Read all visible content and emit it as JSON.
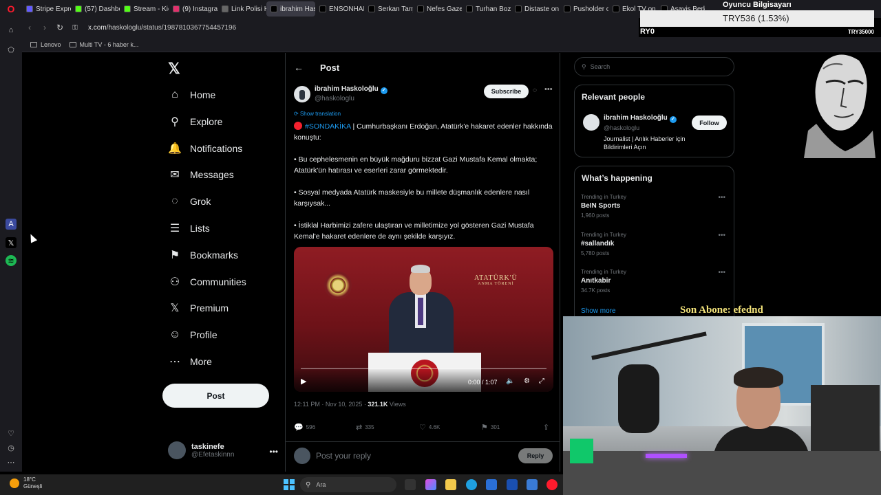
{
  "browser": {
    "tabs": [
      {
        "label": "Stripe Express",
        "color": "#635bff"
      },
      {
        "label": "(57) Dashboar",
        "color": "#53fc18"
      },
      {
        "label": "Stream - Kick",
        "color": "#53fc18"
      },
      {
        "label": "(9) Instagram",
        "color": "#e1306c"
      },
      {
        "label": "Link Polisi Hak",
        "color": "#666666"
      },
      {
        "label": "ibrahim Haskoloğlu on",
        "color": "#000000",
        "active": true
      },
      {
        "label": "ENSONHABER",
        "color": "#000000"
      },
      {
        "label": "Serkan Tanyıld",
        "color": "#000000"
      },
      {
        "label": "Nefes Gazete",
        "color": "#000000"
      },
      {
        "label": "Turhan Bozku",
        "color": "#000000"
      },
      {
        "label": "Distaste on X",
        "color": "#000000"
      },
      {
        "label": "Pusholder on",
        "color": "#000000"
      },
      {
        "label": "Ekol TV on X",
        "color": "#000000"
      },
      {
        "label": "Asayis Berkm",
        "color": "#000000"
      }
    ],
    "url_host": "x.com",
    "url_path": "/haskologlu/status/1987810367754457196",
    "bookmarks": [
      "Lenovo",
      "Multi TV - 6 haber k..."
    ]
  },
  "nav": {
    "items": [
      {
        "label": "Home",
        "icon": "⌂"
      },
      {
        "label": "Explore",
        "icon": "⚲"
      },
      {
        "label": "Notifications",
        "icon": "🔔"
      },
      {
        "label": "Messages",
        "icon": "✉"
      },
      {
        "label": "Grok",
        "icon": "◌"
      },
      {
        "label": "Lists",
        "icon": "☰"
      },
      {
        "label": "Bookmarks",
        "icon": "⚑"
      },
      {
        "label": "Communities",
        "icon": "⚇"
      },
      {
        "label": "Premium",
        "icon": "𝕏"
      },
      {
        "label": "Profile",
        "icon": "☺"
      },
      {
        "label": "More",
        "icon": "⋯"
      }
    ],
    "post_button": "Post",
    "account_name": "taskinefe",
    "account_handle": "@Efetaskinnn"
  },
  "post": {
    "header_title": "Post",
    "author_name": "ibrahim Haskoloğlu",
    "author_handle": "@haskologlu",
    "subscribe": "Subscribe",
    "show_translation": "Show translation",
    "hashtag": "#SONDAKİKA",
    "text_intro": "| Cumhurbaşkanı Erdoğan, Atatürk'e hakaret edenler hakkında konuştu:",
    "para1": "• Bu cephelesmenin en büyük mağduru bizzat Gazi Mustafa Kemal olmakta; Atatürk'ün hatırası ve eserleri zarar görmektedir.",
    "para2": "• Sosyal medyada Atatürk maskesiyle bu millete düşmanlık edenlere nasıl karşıysak...",
    "para3": "• İstiklal Harbimizi zafere ulaştıran ve milletimize yol gösteren Gazi Mustafa Kemal'e hakaret edenlere de aynı şekilde karşıyız.",
    "video_caption": "ATATÜRK'Ü",
    "video_caption2": "ANMA TÖRENİ",
    "video_time": "0:00 / 1:07",
    "video_progress": 0,
    "timestamp": "12:11 PM · Nov 10, 2025 · ",
    "views_count": "321.1K",
    "views_label": " Views",
    "replies": "596",
    "reposts": "335",
    "likes": "4.6K",
    "bookmarks": "301",
    "reply_placeholder": "Post your reply",
    "reply_button": "Reply"
  },
  "right": {
    "search_placeholder": "Search",
    "relevant_title": "Relevant people",
    "rp_name": "ibrahim Haskoloğlu",
    "rp_handle": "@haskologlu",
    "rp_bio": "Journalist | Anlık Haberler için Bildirimleri Açın",
    "follow": "Follow",
    "happening_title": "What’s happening",
    "trends": [
      {
        "context": "Trending in Turkey",
        "name": "BeIN Sports",
        "count": "1,960 posts"
      },
      {
        "context": "Trending in Turkey",
        "name": "#sallandık",
        "count": "5,780 posts"
      },
      {
        "context": "Trending in Turkey",
        "name": "Anıtkabir",
        "count": "34.7K posts"
      }
    ],
    "show_more": "Show more"
  },
  "overlay": {
    "title": "Oyuncu Bilgisayarı",
    "subtitle": "TRY536 (1.53%)",
    "left_text": "RY0",
    "right_text": "TRY35000",
    "son_abone": "Son Abone: efednd"
  },
  "taskbar": {
    "temp": "18°C",
    "weather": "Güneşli",
    "search": "Ara"
  }
}
